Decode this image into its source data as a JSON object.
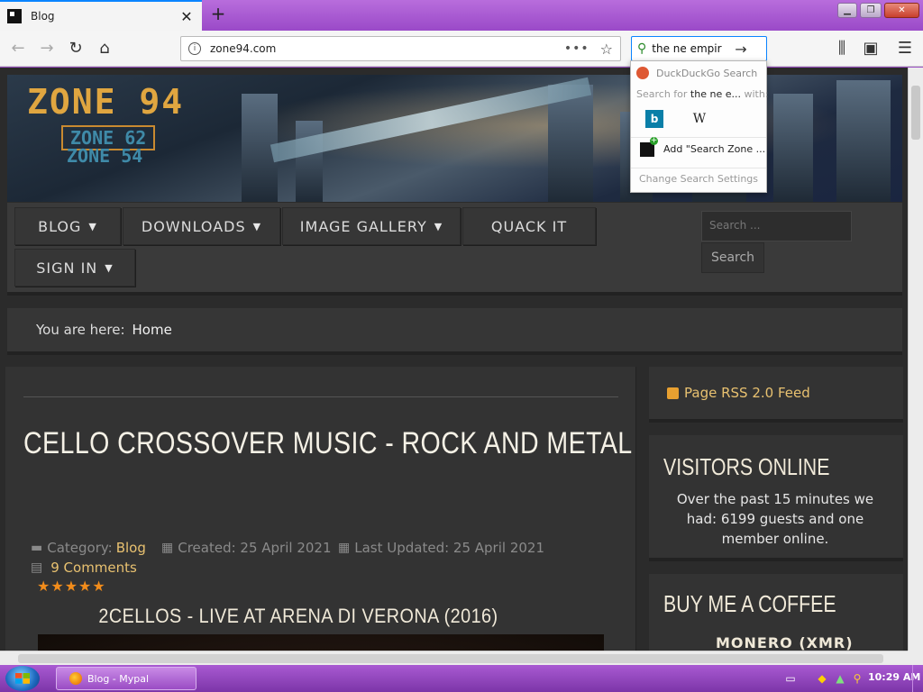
{
  "browser": {
    "tab": {
      "title": "Blog"
    },
    "url": "zone94.com",
    "search": {
      "query": "the ne empir",
      "popup": {
        "engine_header": "DuckDuckGo Search",
        "search_for_prefix": "Search for",
        "search_for_query": "the ne e...",
        "search_for_suffix": "with:",
        "engines": [
          {
            "name": "Bing",
            "glyph": "b"
          },
          {
            "name": "Wikipedia",
            "glyph": "W"
          }
        ],
        "add_engine_label": "Add \"Search Zone ...",
        "change_settings": "Change Search Settings"
      }
    }
  },
  "site": {
    "logo": {
      "main": "ZONE 94",
      "sub1": "ZONE 62",
      "sub2": "ZONE 54"
    },
    "menu": {
      "blog": "BLOG",
      "downloads": "DOWNLOADS",
      "image_gallery": "IMAGE GALLERY",
      "quack_it": "QUACK IT",
      "sign_in": "SIGN IN",
      "search_placeholder": "Search ...",
      "search_button": "Search"
    },
    "breadcrumb": {
      "label": "You are here:",
      "home": "Home"
    },
    "article": {
      "title": "CELLO CROSSOVER MUSIC - ROCK AND METAL",
      "category_label": "Category:",
      "category": "Blog",
      "created": "Created: 25 April 2021",
      "updated": "Last Updated: 25 April 2021",
      "comments": "9 Comments",
      "rating": 5,
      "rating_glyphs": "★★★★★",
      "video_title": "2CELLOS - LIVE AT ARENA DI VERONA (2016)"
    },
    "sidebar": {
      "rss": "Page RSS 2.0 Feed",
      "visitors_title": "VISITORS ONLINE",
      "visitors_text": "Over the past 15 minutes we had: 6199 guests and one member online.",
      "coffee_title": "BUY ME A COFFEE",
      "coffee_sub": "MONERO (XMR)"
    }
  },
  "taskbar": {
    "window_label": "Blog - Mypal",
    "clock": "10:29 AM"
  },
  "colors": {
    "accent_link": "#e8c170",
    "rating": "#f28c1b",
    "taskbar": "#9a4cc4",
    "page_bg": "#2b2b2b"
  }
}
